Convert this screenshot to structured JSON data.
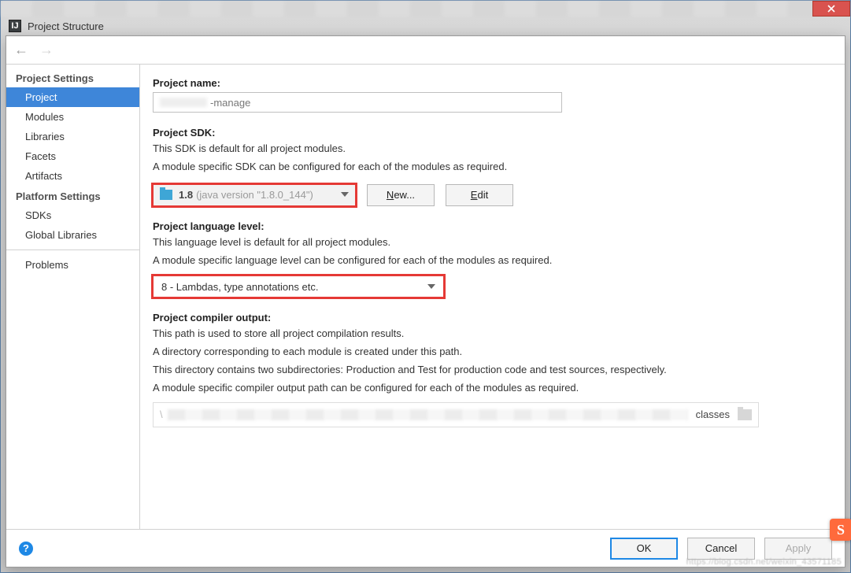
{
  "window": {
    "title": "Project Structure"
  },
  "sidebar": {
    "heading_settings": "Project Settings",
    "heading_platform": "Platform Settings",
    "items_settings": [
      "Project",
      "Modules",
      "Libraries",
      "Facets",
      "Artifacts"
    ],
    "items_platform": [
      "SDKs",
      "Global Libraries"
    ],
    "problems": "Problems"
  },
  "project_name": {
    "label": "Project name:",
    "value": "-manage"
  },
  "project_sdk": {
    "label": "Project SDK:",
    "desc1": "This SDK is default for all project modules.",
    "desc2": "A module specific SDK can be configured for each of the modules as required.",
    "combo_main": "1.8",
    "combo_hint": "(java version \"1.8.0_144\")",
    "new_btn": "New...",
    "edit_btn": "Edit"
  },
  "lang_level": {
    "label": "Project language level:",
    "desc1": "This language level is default for all project modules.",
    "desc2": "A module specific language level can be configured for each of the modules as required.",
    "combo": "8 - Lambdas, type annotations etc."
  },
  "compiler": {
    "label": "Project compiler output:",
    "desc1": "This path is used to store all project compilation results.",
    "desc2": "A directory corresponding to each module is created under this path.",
    "desc3": "This directory contains two subdirectories: Production and Test for production code and test sources, respectively.",
    "desc4": "A module specific compiler output path can be configured for each of the modules as required.",
    "tail": "classes"
  },
  "footer": {
    "ok": "OK",
    "cancel": "Cancel",
    "apply": "Apply"
  },
  "misc": {
    "badge": "S"
  }
}
